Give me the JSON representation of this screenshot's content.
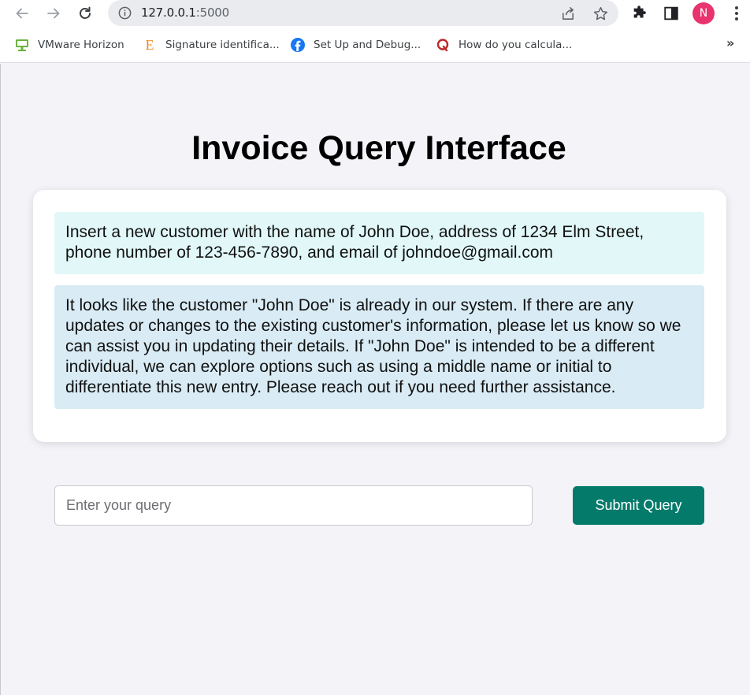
{
  "browser": {
    "url_host": "127.0.0.1",
    "url_port": ":5000",
    "profile_initial": "N",
    "bookmarks": [
      {
        "label": "VMware Horizon",
        "icon": "vmware-icon"
      },
      {
        "label": "Signature identifica...",
        "icon": "e-logo-icon"
      },
      {
        "label": "Set Up and Debug...",
        "icon": "facebook-icon"
      },
      {
        "label": "How do you calcula...",
        "icon": "quora-icon"
      }
    ],
    "more_bookmarks": "»"
  },
  "page": {
    "title": "Invoice Query Interface",
    "messages": [
      {
        "role": "user",
        "text": "Insert a new customer with the name of John Doe, address of 1234 Elm Street, phone number of 123-456-7890, and email of johndoe@gmail.com"
      },
      {
        "role": "assistant",
        "text": "It looks like the customer \"John Doe\" is already in our system. If there are any updates or changes to the existing customer's information, please let us know so we can assist you in updating their details. If \"John Doe\" is intended to be a different individual, we can explore options such as using a middle name or initial to differentiate this new entry. Please reach out if you need further assistance."
      }
    ],
    "query": {
      "value": "",
      "placeholder": "Enter your query"
    },
    "submit_label": "Submit Query"
  },
  "colors": {
    "accent": "#047a6b",
    "user_bubble": "#e1f7f8",
    "assistant_bubble": "#d9ebf4",
    "page_background": "#f4f3f8",
    "avatar": "#e8336e"
  }
}
